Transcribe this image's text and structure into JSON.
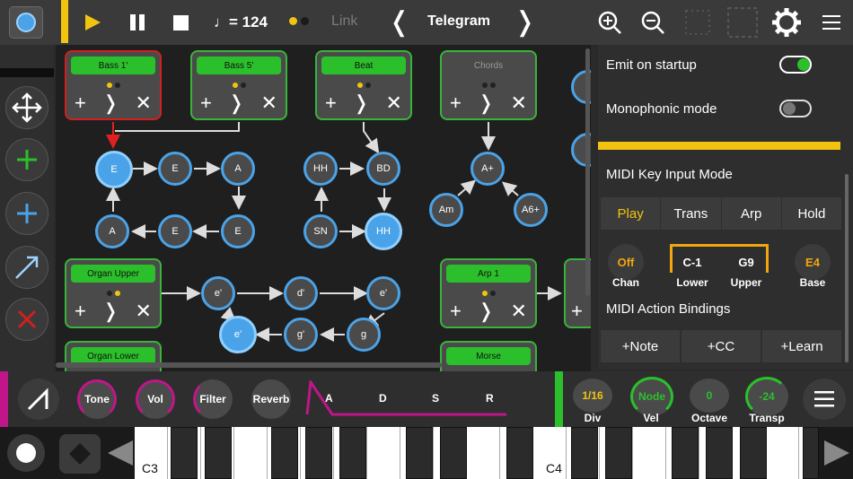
{
  "toolbar": {
    "tempo": "♩= 124",
    "link_label": "Link",
    "song_title": "Telegram",
    "prev_glyph": "❬",
    "next_glyph": "❭"
  },
  "cards": [
    {
      "title": "Bass 1'",
      "dots": [
        "#f2c40f",
        "#222"
      ]
    },
    {
      "title": "Bass 5'",
      "dots": [
        "#f2c40f",
        "#222"
      ]
    },
    {
      "title": "Beat",
      "dots": [
        "#f2c40f",
        "#222"
      ]
    },
    {
      "title": "Chords",
      "dots": [
        "#222",
        "#222"
      ]
    },
    {
      "title": "Organ Upper",
      "dots": [
        "#222",
        "#f2c40f"
      ]
    },
    {
      "title": "Arp 1",
      "dots": [
        "#f2c40f",
        "#222"
      ]
    },
    {
      "title": "Organ Lower",
      "dots": []
    },
    {
      "title": "Morse",
      "dots": []
    }
  ],
  "card_controls": {
    "add": "+",
    "next": "❭",
    "close": "✕"
  },
  "nodes": {
    "bass": [
      "E",
      "E",
      "A",
      "A",
      "E",
      "E"
    ],
    "beat": [
      "HH",
      "BD",
      "SN",
      "HH"
    ],
    "chords": [
      "A+",
      "Am",
      "A6+"
    ],
    "organ": [
      "e'",
      "d'",
      "e'",
      "e'",
      "g'",
      "g"
    ]
  },
  "settings": {
    "emit_on_startup": "Emit on startup",
    "monophonic_mode": "Monophonic mode",
    "midi_key_input_mode": "MIDI Key Input Mode",
    "modes": [
      "Play",
      "Trans",
      "Arp",
      "Hold"
    ],
    "chan_value": "Off",
    "chan_label": "Chan",
    "lower_value": "C-1",
    "lower_label": "Lower",
    "upper_value": "G9",
    "upper_label": "Upper",
    "base_value": "E4",
    "base_label": "Base",
    "midi_action_bindings": "MIDI Action Bindings",
    "bindings": [
      "+Note",
      "+CC",
      "+Learn"
    ]
  },
  "synth": {
    "tone": "Tone",
    "vol": "Vol",
    "filter": "Filter",
    "reverb": "Reverb",
    "adsr": [
      "A",
      "D",
      "S",
      "R"
    ],
    "div_value": "1/16",
    "div_label": "Div",
    "vel_value": "Node",
    "vel_label": "Vel",
    "octave_value": "0",
    "octave_label": "Octave",
    "transp_value": "-24",
    "transp_label": "Transp"
  },
  "keyboard": {
    "c3": "C3",
    "c4": "C4"
  },
  "colors": {
    "accent_yellow": "#f2c40f",
    "green": "#2bc02b",
    "blue": "#4aa3e8",
    "magenta": "#c0168a",
    "red": "#d02020",
    "orange": "#f2a50f"
  }
}
